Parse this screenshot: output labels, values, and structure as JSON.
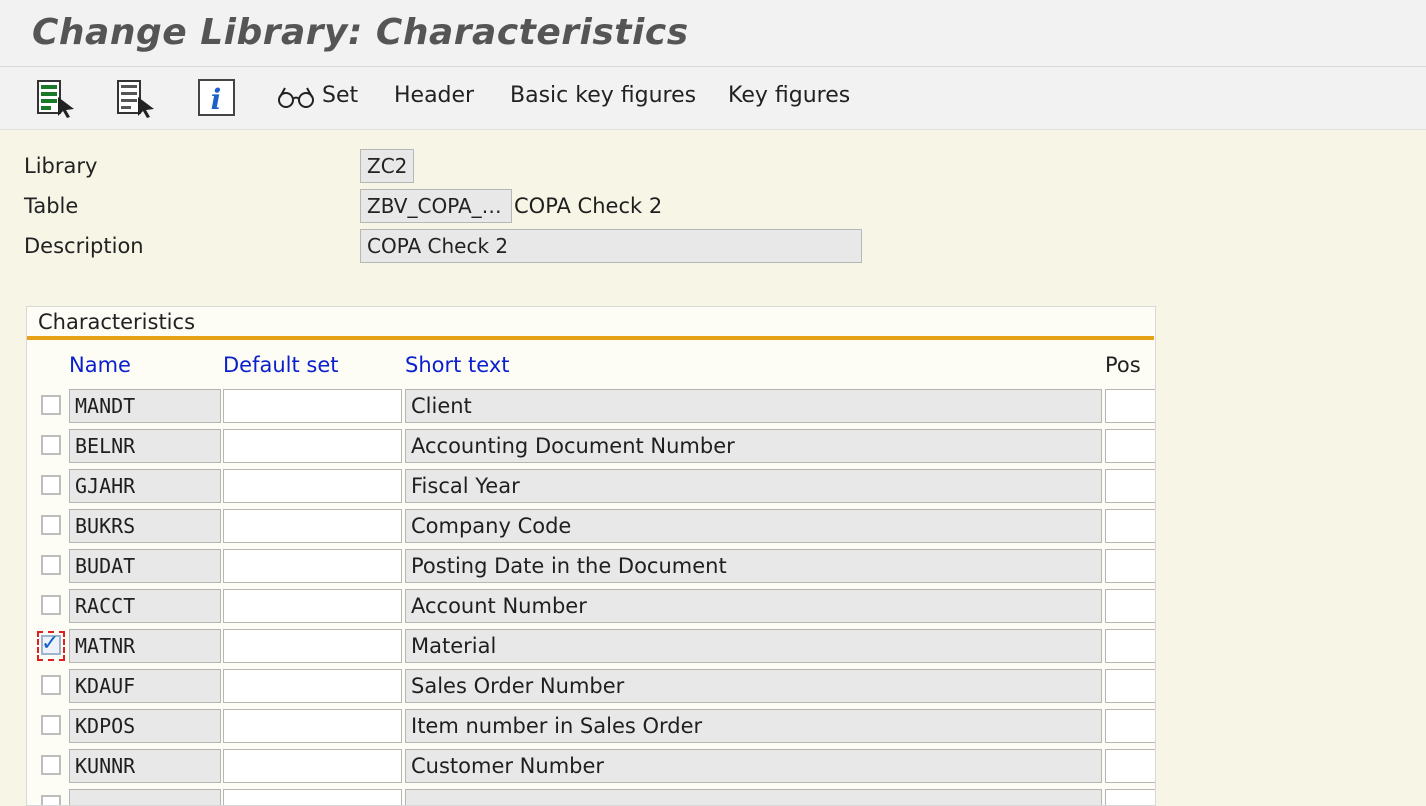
{
  "window": {
    "title": "Change Library: Characteristics"
  },
  "toolbar": {
    "icons": [
      "select-all-icon",
      "deselect-all-icon",
      "info-icon",
      "glasses-icon"
    ],
    "set_label": "Set",
    "header_label": "Header",
    "basic_key_figures_label": "Basic key figures",
    "key_figures_label": "Key figures"
  },
  "form": {
    "library_label": "Library",
    "library_value": "ZC2",
    "table_label": "Table",
    "table_value": "ZBV_COPA_…",
    "table_description": "COPA Check 2",
    "description_label": "Description",
    "description_value": "COPA Check 2"
  },
  "characteristics": {
    "title": "Characteristics",
    "accent_color": "#e5a217",
    "header_color": "#0a1fcd",
    "columns": {
      "name": "Name",
      "default_set": "Default set",
      "short_text": "Short text",
      "pos": "Pos"
    },
    "rows": [
      {
        "name": "MANDT",
        "default_set": "",
        "short_text": "Client",
        "pos": "",
        "checked": false
      },
      {
        "name": "BELNR",
        "default_set": "",
        "short_text": "Accounting Document Number",
        "pos": "",
        "checked": false
      },
      {
        "name": "GJAHR",
        "default_set": "",
        "short_text": "Fiscal Year",
        "pos": "",
        "checked": false
      },
      {
        "name": "BUKRS",
        "default_set": "",
        "short_text": "Company Code",
        "pos": "",
        "checked": false
      },
      {
        "name": "BUDAT",
        "default_set": "",
        "short_text": "Posting Date in the Document",
        "pos": "",
        "checked": false
      },
      {
        "name": "RACCT",
        "default_set": "",
        "short_text": "Account Number",
        "pos": "",
        "checked": false
      },
      {
        "name": "MATNR",
        "default_set": "",
        "short_text": "Material",
        "pos": "",
        "checked": true
      },
      {
        "name": "KDAUF",
        "default_set": "",
        "short_text": "Sales Order Number",
        "pos": "",
        "checked": false
      },
      {
        "name": "KDPOS",
        "default_set": "",
        "short_text": "Item number in Sales Order",
        "pos": "",
        "checked": false
      },
      {
        "name": "KUNNR",
        "default_set": "",
        "short_text": "Customer Number",
        "pos": "",
        "checked": false
      },
      {
        "name": "",
        "default_set": "",
        "short_text": "",
        "pos": "",
        "checked": false
      }
    ]
  }
}
